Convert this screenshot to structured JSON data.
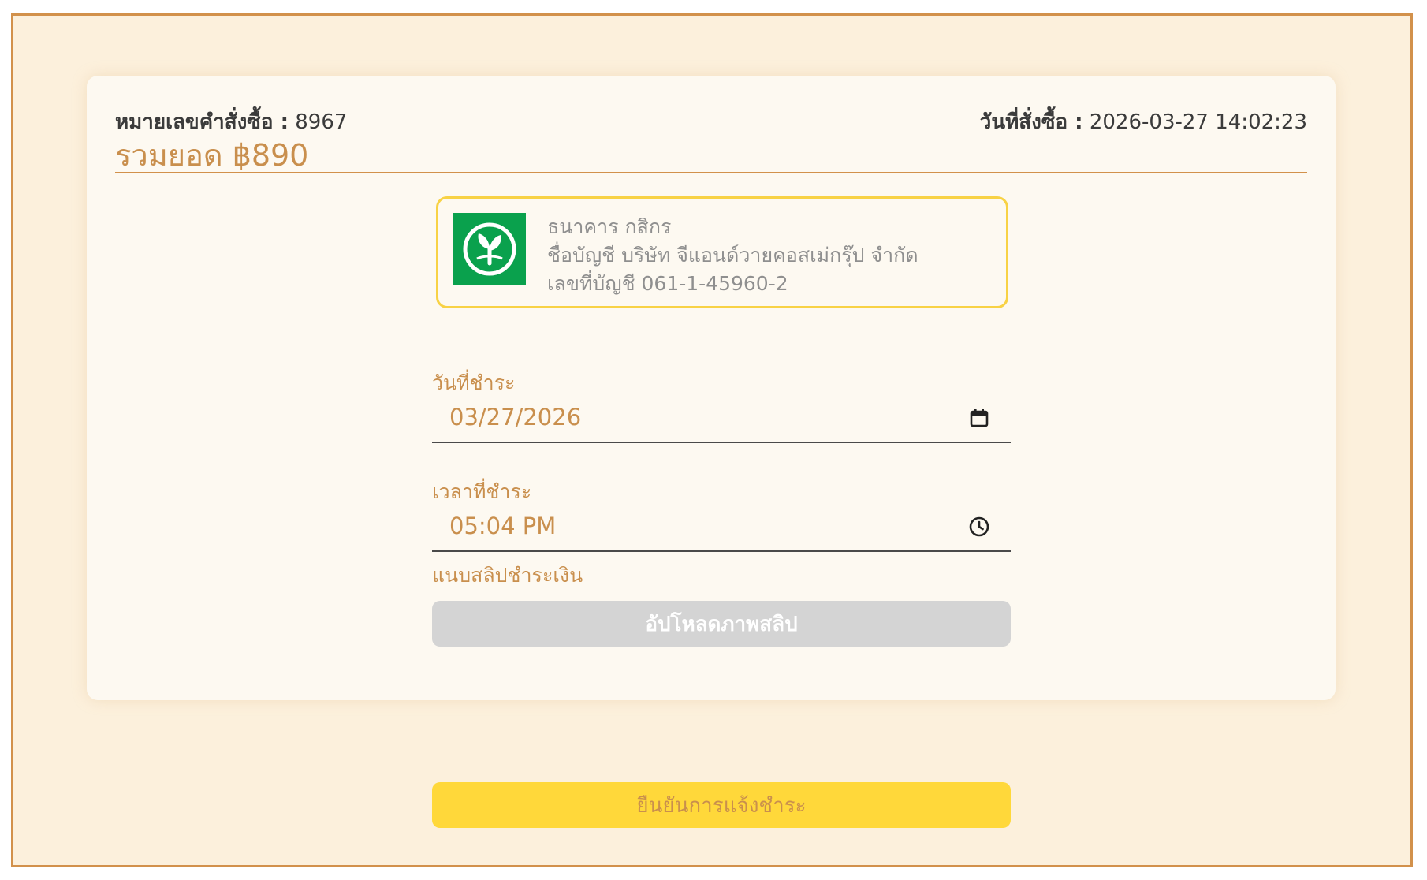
{
  "header": {
    "order_number_label": "หมายเลขคำสั่งซื้อ :",
    "order_number": "8967",
    "order_date_label": "วันที่สั่งซื้อ :",
    "order_date": "2026-03-27 14:02:23",
    "total": "รวมยอด ฿890"
  },
  "bank": {
    "name": "ธนาคาร กสิกร",
    "account_name": "ชื่อบัญชี บริษัท จีแอนด์วายคอสเม่กรุ๊ป จำกัด",
    "account_number": "เลขที่บัญชี 061-1-45960-2",
    "logo_icon": "kasikorn-bank-logo",
    "logo_color": "#0aa14d"
  },
  "payment_date": {
    "label": "วันที่ชำระ",
    "value": "03/27/2026",
    "icon": "calendar-icon"
  },
  "payment_time": {
    "label": "เวลาที่ชำระ",
    "value": "05:04 PM",
    "icon": "clock-icon"
  },
  "slip": {
    "label": "แนบสลิปชำระเงิน",
    "upload_button": "อัปโหลดภาพสลิป"
  },
  "confirm_button": "ยืนยันการแจ้งชำระ",
  "colors": {
    "accent": "#c98f4d",
    "border": "#d2914b",
    "highlight": "#ffd83a",
    "background": "#fcf0dc",
    "disabled": "#d4d4d4"
  }
}
